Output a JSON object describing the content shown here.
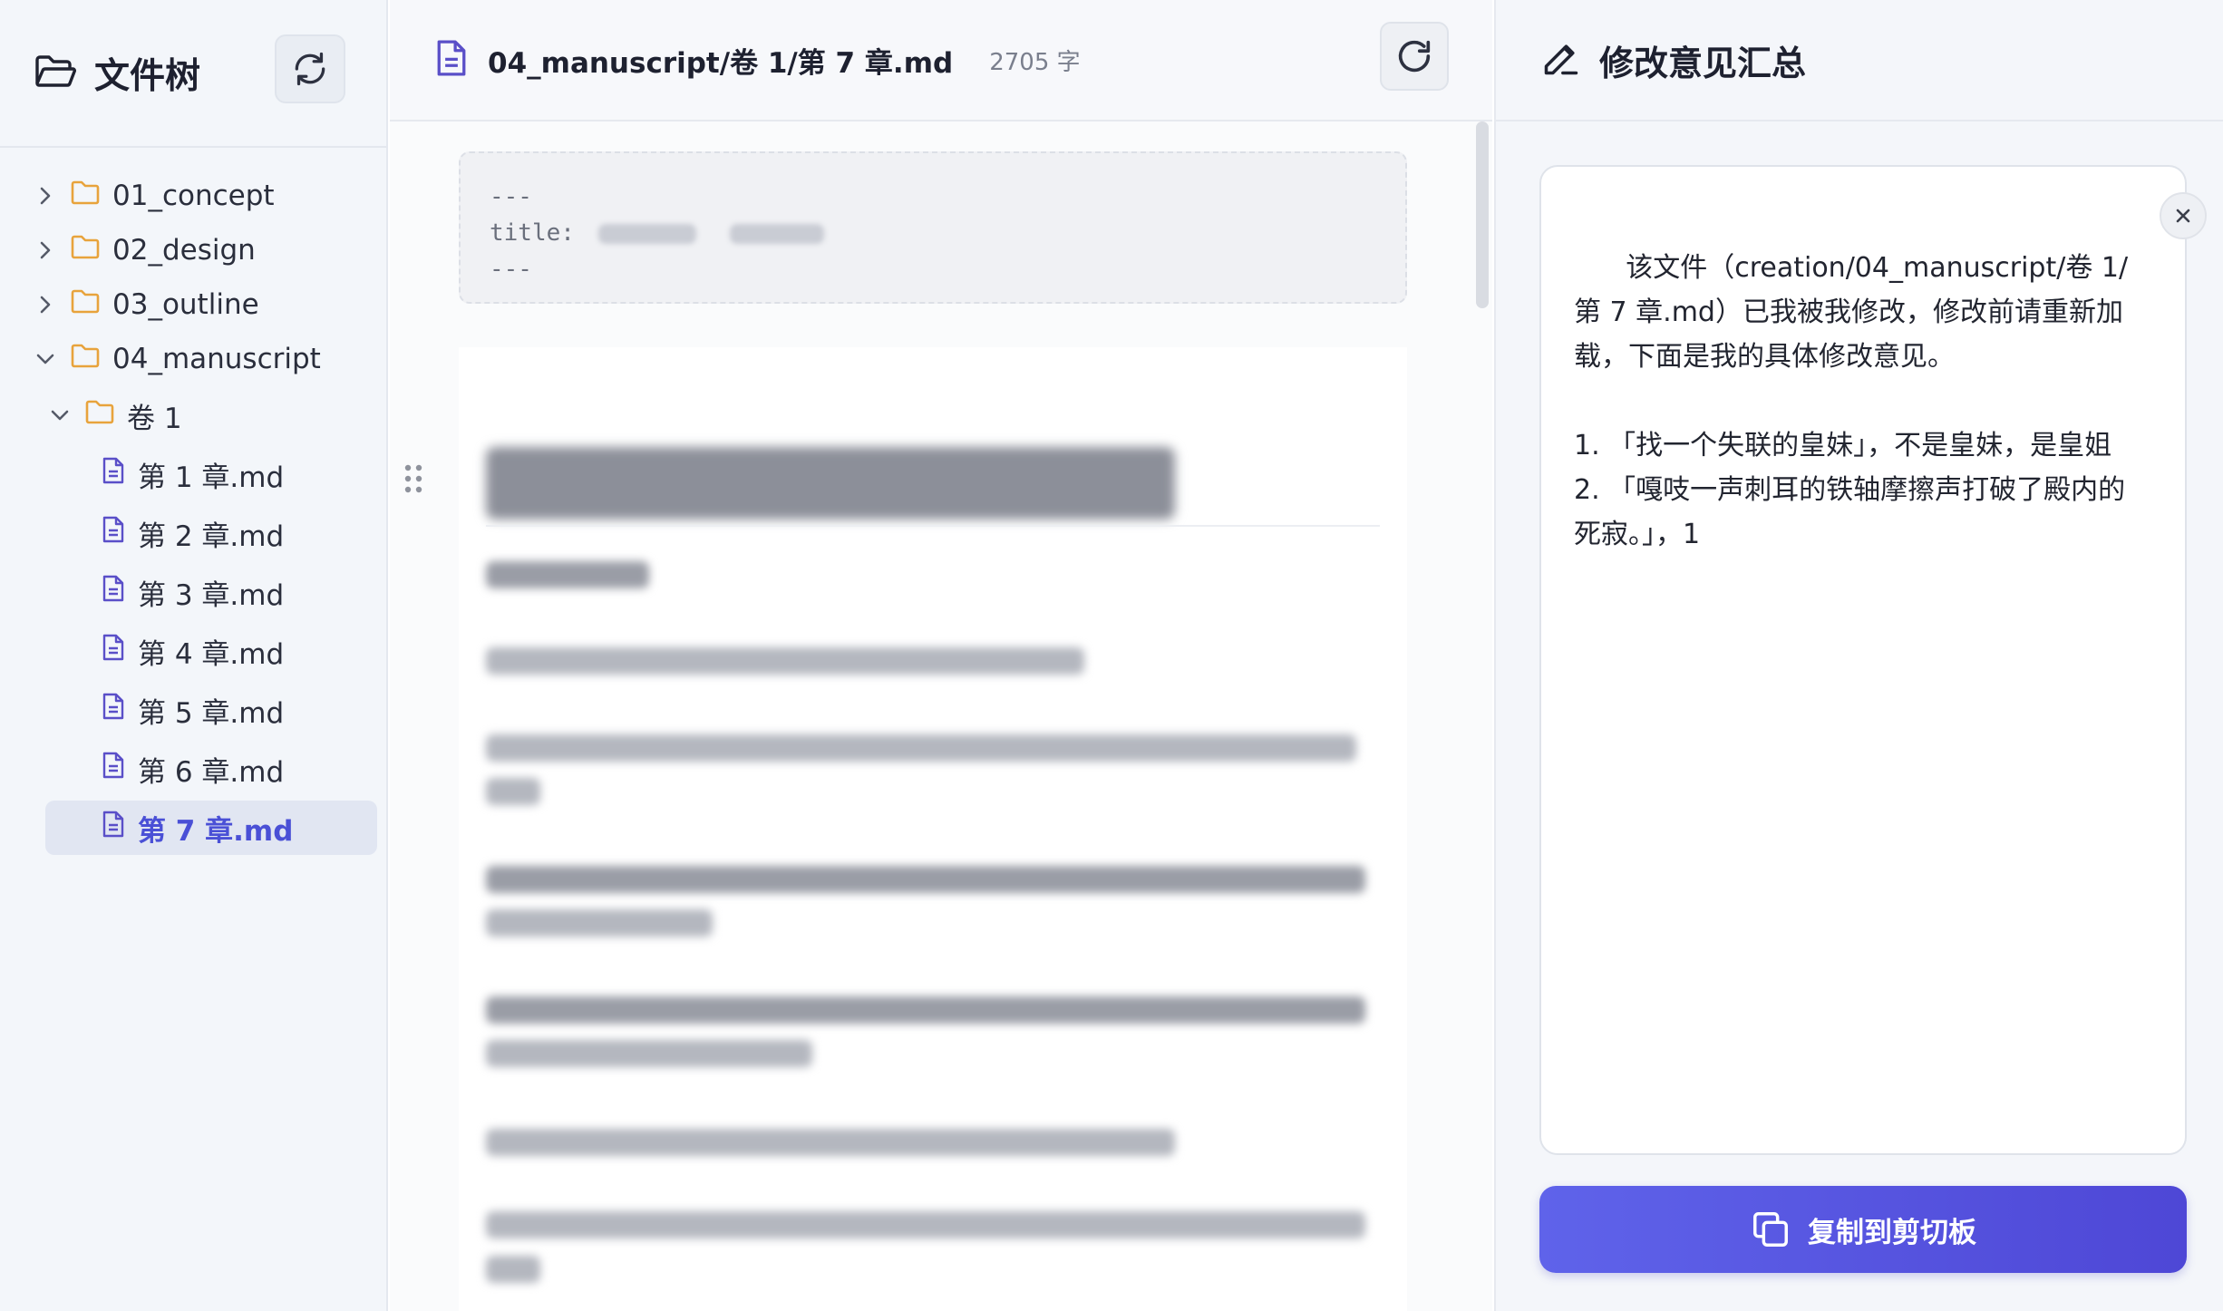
{
  "sidebar": {
    "title": "文件树",
    "tree": [
      {
        "label": "01_concept",
        "type": "folder",
        "expanded": false,
        "depth": 0
      },
      {
        "label": "02_design",
        "type": "folder",
        "expanded": false,
        "depth": 0
      },
      {
        "label": "03_outline",
        "type": "folder",
        "expanded": false,
        "depth": 0
      },
      {
        "label": "04_manuscript",
        "type": "folder",
        "expanded": true,
        "depth": 0
      },
      {
        "label": "卷 1",
        "type": "folder",
        "expanded": true,
        "depth": 1
      },
      {
        "label": "第 1 章.md",
        "type": "file",
        "depth": 2
      },
      {
        "label": "第 2 章.md",
        "type": "file",
        "depth": 2
      },
      {
        "label": "第 3 章.md",
        "type": "file",
        "depth": 2
      },
      {
        "label": "第 4 章.md",
        "type": "file",
        "depth": 2
      },
      {
        "label": "第 5 章.md",
        "type": "file",
        "depth": 2
      },
      {
        "label": "第 6 章.md",
        "type": "file",
        "depth": 2
      },
      {
        "label": "第 7 章.md",
        "type": "file",
        "depth": 2,
        "active": true
      }
    ]
  },
  "editor": {
    "filename": "04_manuscript/卷 1/第 7 章.md",
    "char_count": "2705 字",
    "frontmatter": {
      "open": "---",
      "title_key": "title:",
      "close": "---"
    }
  },
  "review": {
    "title": "修改意见汇总",
    "comment": "该文件（creation/04_manuscript/卷 1/第 7 章.md）已我被我修改，修改前请重新加载，下面是我的具体修改意见。\n\n1. 「找一个失联的皇妹」，不是皇妹，是皇姐\n2. 「嘎吱一声刺耳的铁轴摩擦声打破了殿内的死寂。」，1",
    "copy_label": "复制到剪切板"
  },
  "colors": {
    "accent": "#5b5fe6",
    "folder": "#e8a33c",
    "file": "#5a4fc8"
  }
}
